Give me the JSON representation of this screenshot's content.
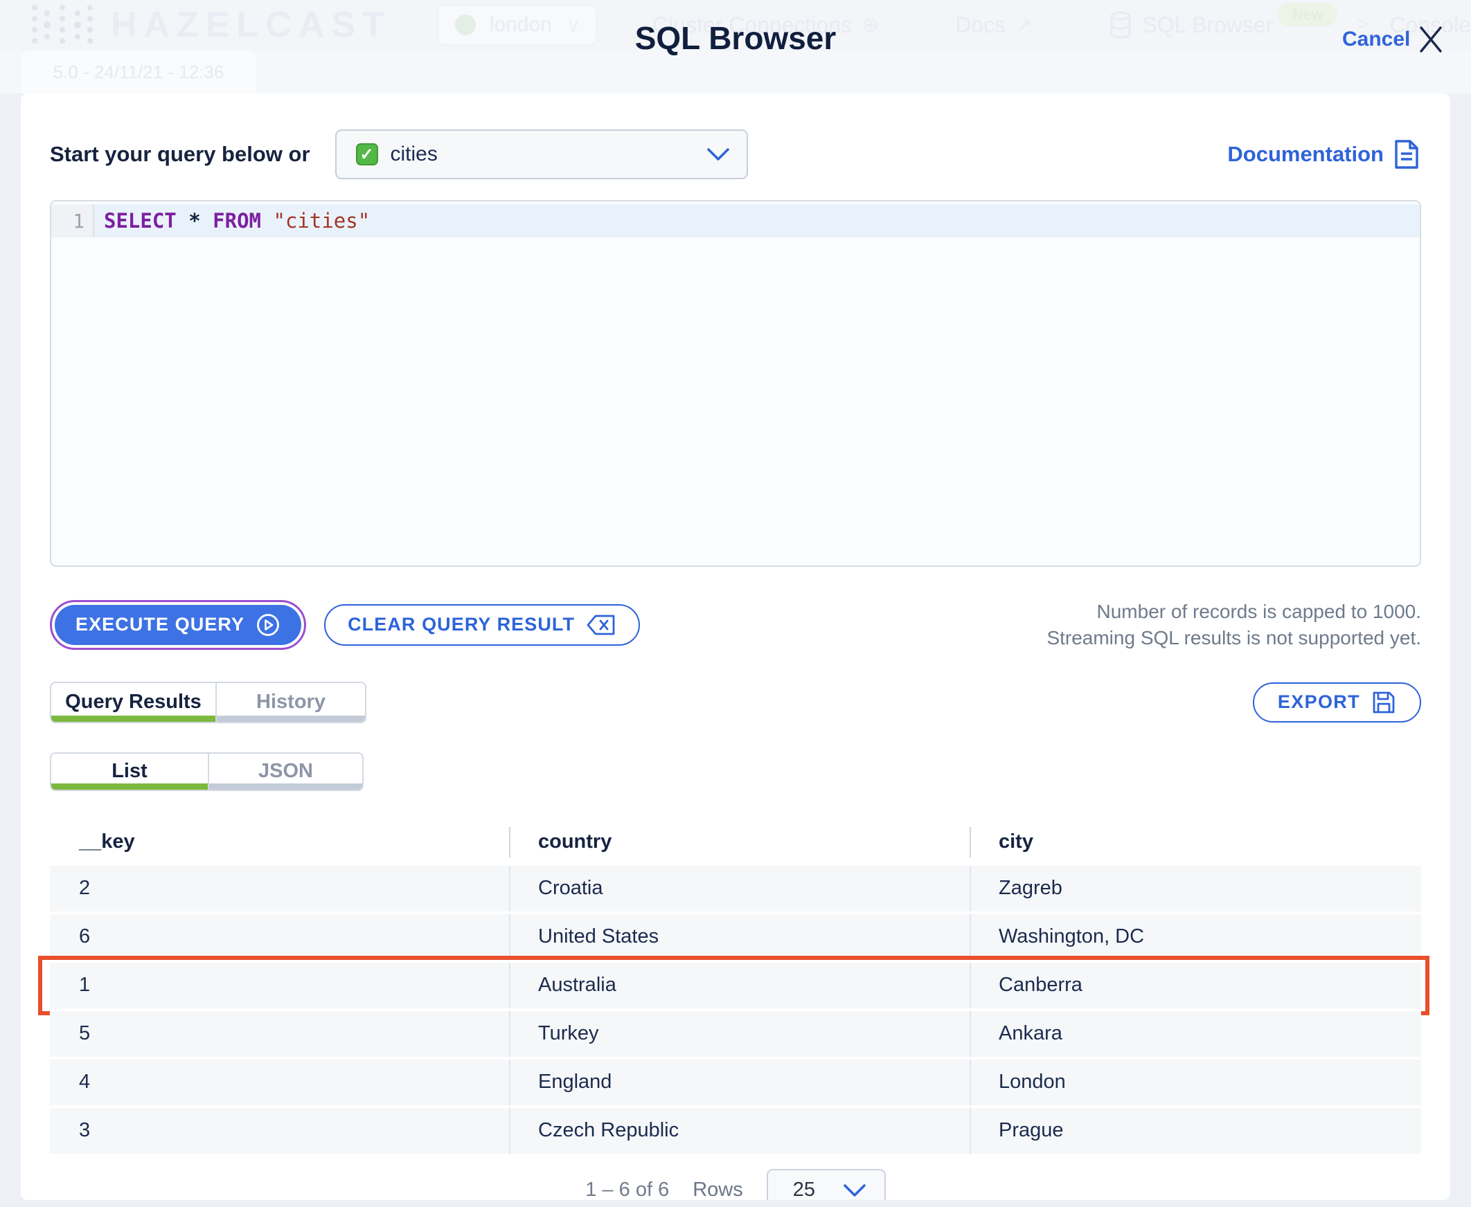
{
  "background": {
    "brand": "HAZELCAST",
    "cluster_name": "london",
    "nav_cluster_connections": "Cluster Connections",
    "nav_docs": "Docs",
    "nav_sql_browser": "SQL Browser",
    "nav_console": "Console",
    "console_prompt": ">_",
    "new_badge": "New",
    "version_info": "5.0 - 24/11/21 - 12:36"
  },
  "header": {
    "title": "SQL Browser",
    "cancel_label": "Cancel"
  },
  "query_bar": {
    "prompt": "Start your query below or",
    "map_select_value": "cities",
    "documentation_label": "Documentation"
  },
  "editor": {
    "line_number": "1",
    "query": "SELECT * FROM \"cities\"",
    "sql": {
      "select": "SELECT",
      "sp1": " ",
      "star": "*",
      "sp2": " ",
      "from": "FROM",
      "sp3": " ",
      "table": "\"cities\""
    }
  },
  "actions": {
    "execute_label": "EXECUTE QUERY",
    "clear_label": "CLEAR QUERY RESULT",
    "note_line1": "Number of records is capped to 1000.",
    "note_line2": "Streaming SQL results is not supported yet.",
    "export_label": "EXPORT"
  },
  "tabs": {
    "results": [
      {
        "label": "Query Results",
        "active": true
      },
      {
        "label": "History",
        "active": false
      }
    ],
    "view": [
      {
        "label": "List",
        "active": true
      },
      {
        "label": "JSON",
        "active": false
      }
    ]
  },
  "table": {
    "columns": [
      "__key",
      "country",
      "city"
    ],
    "rows": [
      {
        "__key": "2",
        "country": "Croatia",
        "city": "Zagreb",
        "highlighted": false
      },
      {
        "__key": "6",
        "country": "United States",
        "city": "Washington, DC",
        "highlighted": false
      },
      {
        "__key": "1",
        "country": "Australia",
        "city": "Canberra",
        "highlighted": true
      },
      {
        "__key": "5",
        "country": "Turkey",
        "city": "Ankara",
        "highlighted": false
      },
      {
        "__key": "4",
        "country": "England",
        "city": "London",
        "highlighted": false
      },
      {
        "__key": "3",
        "country": "Czech Republic",
        "city": "Prague",
        "highlighted": false
      }
    ]
  },
  "pagination": {
    "range": "1 – 6 of 6",
    "rows_label": "Rows",
    "rows_per_page": "25"
  },
  "colors": {
    "accent_blue": "#2e63d9",
    "execute_blue": "#3d72e4",
    "focus_purple": "#9b4fd0",
    "tab_green": "#7cb93e",
    "highlight_red": "#e8502c",
    "navy": "#16233f",
    "muted_gray": "#6f7a8b",
    "keyword_purple": "#7d1fa0",
    "string_red": "#a33524"
  }
}
